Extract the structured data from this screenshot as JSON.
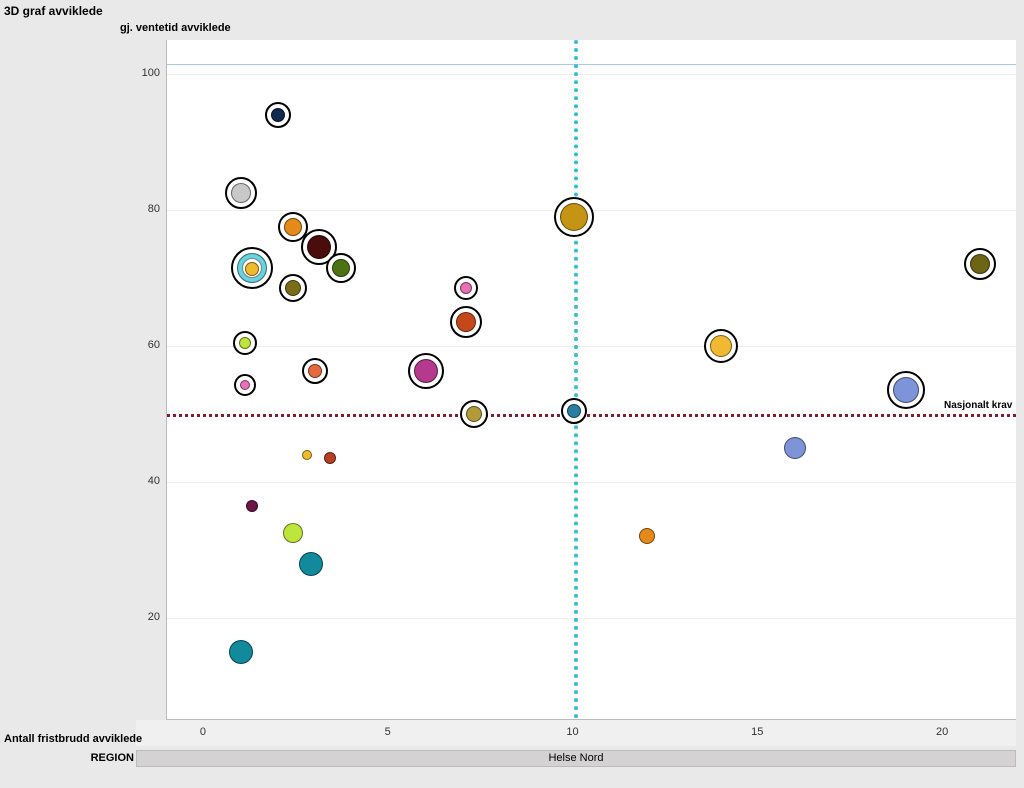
{
  "title": "3D graf avviklede",
  "ylabel": "gj. ventetid avviklede",
  "xlabel": "Antall fristbrudd avviklede",
  "region_label": "REGION",
  "region_value": "Helse Nord",
  "chart_data": {
    "type": "scatter",
    "xlabel": "Antall fristbrudd avviklede",
    "ylabel": "gj. ventetid avviklede",
    "xlim": [
      -1,
      22
    ],
    "ylim": [
      5,
      105
    ],
    "yticks": [
      20,
      40,
      60,
      80,
      100
    ],
    "xticks": [
      0,
      5,
      10,
      15,
      20
    ],
    "ref_lines": {
      "horizontal": {
        "value": 50,
        "color": "#8b1a2f",
        "label": "Nasjonalt krav"
      },
      "vertical": {
        "value": 10,
        "color": "#32bfd6"
      }
    },
    "points": [
      {
        "x": 2,
        "y": 94,
        "size": 14,
        "color": "#11294f",
        "ring": true
      },
      {
        "x": 1,
        "y": 82.5,
        "size": 20,
        "color": "#c8c8c8",
        "ring": true
      },
      {
        "x": 2.4,
        "y": 77.5,
        "size": 18,
        "color": "#e58a18",
        "ring": true
      },
      {
        "x": 3.1,
        "y": 74.5,
        "size": 24,
        "color": "#4b0c0c",
        "ring": true
      },
      {
        "x": 3.7,
        "y": 71.5,
        "size": 18,
        "color": "#4c7313",
        "ring": true
      },
      {
        "x": 1.3,
        "y": 71.5,
        "size": 30,
        "color": "#66d4e0",
        "ring": true
      },
      {
        "x": 1.3,
        "y": 71.5,
        "size": 20,
        "color": "#fff",
        "ring": false
      },
      {
        "x": 1.3,
        "y": 71.3,
        "size": 14,
        "color": "#efbb2d",
        "ring": false
      },
      {
        "x": 2.4,
        "y": 68.5,
        "size": 16,
        "color": "#7a6d18",
        "ring": true
      },
      {
        "x": 7.1,
        "y": 68.5,
        "size": 12,
        "color": "#ea6fb9",
        "ring": true
      },
      {
        "x": 1.1,
        "y": 60.5,
        "size": 12,
        "color": "#bee53b",
        "ring": true
      },
      {
        "x": 7.1,
        "y": 63.5,
        "size": 20,
        "color": "#c5481b",
        "ring": true
      },
      {
        "x": 3,
        "y": 56.3,
        "size": 14,
        "color": "#e5693e",
        "ring": true
      },
      {
        "x": 6,
        "y": 56.3,
        "size": 24,
        "color": "#b5398c",
        "ring": true
      },
      {
        "x": 1.1,
        "y": 54.3,
        "size": 10,
        "color": "#ea6fb9",
        "ring": true
      },
      {
        "x": 7.3,
        "y": 50,
        "size": 16,
        "color": "#b19b36",
        "ring": true
      },
      {
        "x": 10,
        "y": 50.5,
        "size": 14,
        "color": "#2b7ea0",
        "ring": true
      },
      {
        "x": 10,
        "y": 79,
        "size": 28,
        "color": "#c59415",
        "ring": true
      },
      {
        "x": 14,
        "y": 60,
        "size": 22,
        "color": "#f0b931",
        "ring": true
      },
      {
        "x": 21,
        "y": 72,
        "size": 20,
        "color": "#6d6515",
        "ring": true
      },
      {
        "x": 19,
        "y": 53.5,
        "size": 26,
        "color": "#7e94d9",
        "ring": true
      },
      {
        "x": 16,
        "y": 45,
        "size": 22,
        "color": "#7e94d9",
        "ring": false
      },
      {
        "x": 12,
        "y": 32,
        "size": 16,
        "color": "#e58a18",
        "ring": false
      },
      {
        "x": 2.8,
        "y": 44,
        "size": 10,
        "color": "#efbb2d",
        "ring": false
      },
      {
        "x": 3.4,
        "y": 43.5,
        "size": 12,
        "color": "#b63f24",
        "ring": false
      },
      {
        "x": 1.3,
        "y": 36.5,
        "size": 12,
        "color": "#6c1547",
        "ring": false
      },
      {
        "x": 2.4,
        "y": 32.5,
        "size": 20,
        "color": "#bee53b",
        "ring": false
      },
      {
        "x": 2.9,
        "y": 28,
        "size": 24,
        "color": "#118a9c",
        "ring": false
      },
      {
        "x": 1,
        "y": 15,
        "size": 24,
        "color": "#118a9c",
        "ring": false
      }
    ]
  }
}
